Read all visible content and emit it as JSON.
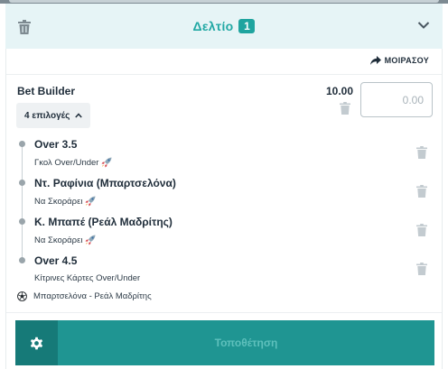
{
  "header": {
    "title": "Δελτίο",
    "count": "1"
  },
  "share": {
    "label": "ΜΟΙΡΑΣΟΥ"
  },
  "bet_builder": {
    "title": "Bet Builder",
    "selections_label": "4 επιλογές",
    "odds": "10.00",
    "stake_placeholder": "0.00"
  },
  "legs": [
    {
      "name": "Over 3.5",
      "market": "Γκολ Over/Under",
      "icon": "rocket-icon"
    },
    {
      "name": "Ντ. Ραφίνια (Μπαρτσελόνα)",
      "market": "Να Σκοράρει",
      "icon": "rocket-icon"
    },
    {
      "name": "Κ. Μπαπέ (Ρεάλ Μαδρίτης)",
      "market": "Να Σκοράρει",
      "icon": "rocket-icon"
    },
    {
      "name": "Over 4.5",
      "market": "Κίτρινες Κάρτες Over/Under",
      "icon": ""
    }
  ],
  "match": {
    "label": "Μπαρτσελόνα - Ρεάλ Μαδρίτης",
    "icon": "football-icon"
  },
  "footer": {
    "place_label": "Τοποθέτηση",
    "icon": "gear-icon"
  },
  "colors": {
    "accent": "#21a8a4",
    "button": "#1f9592",
    "button_dark": "#167a78"
  }
}
